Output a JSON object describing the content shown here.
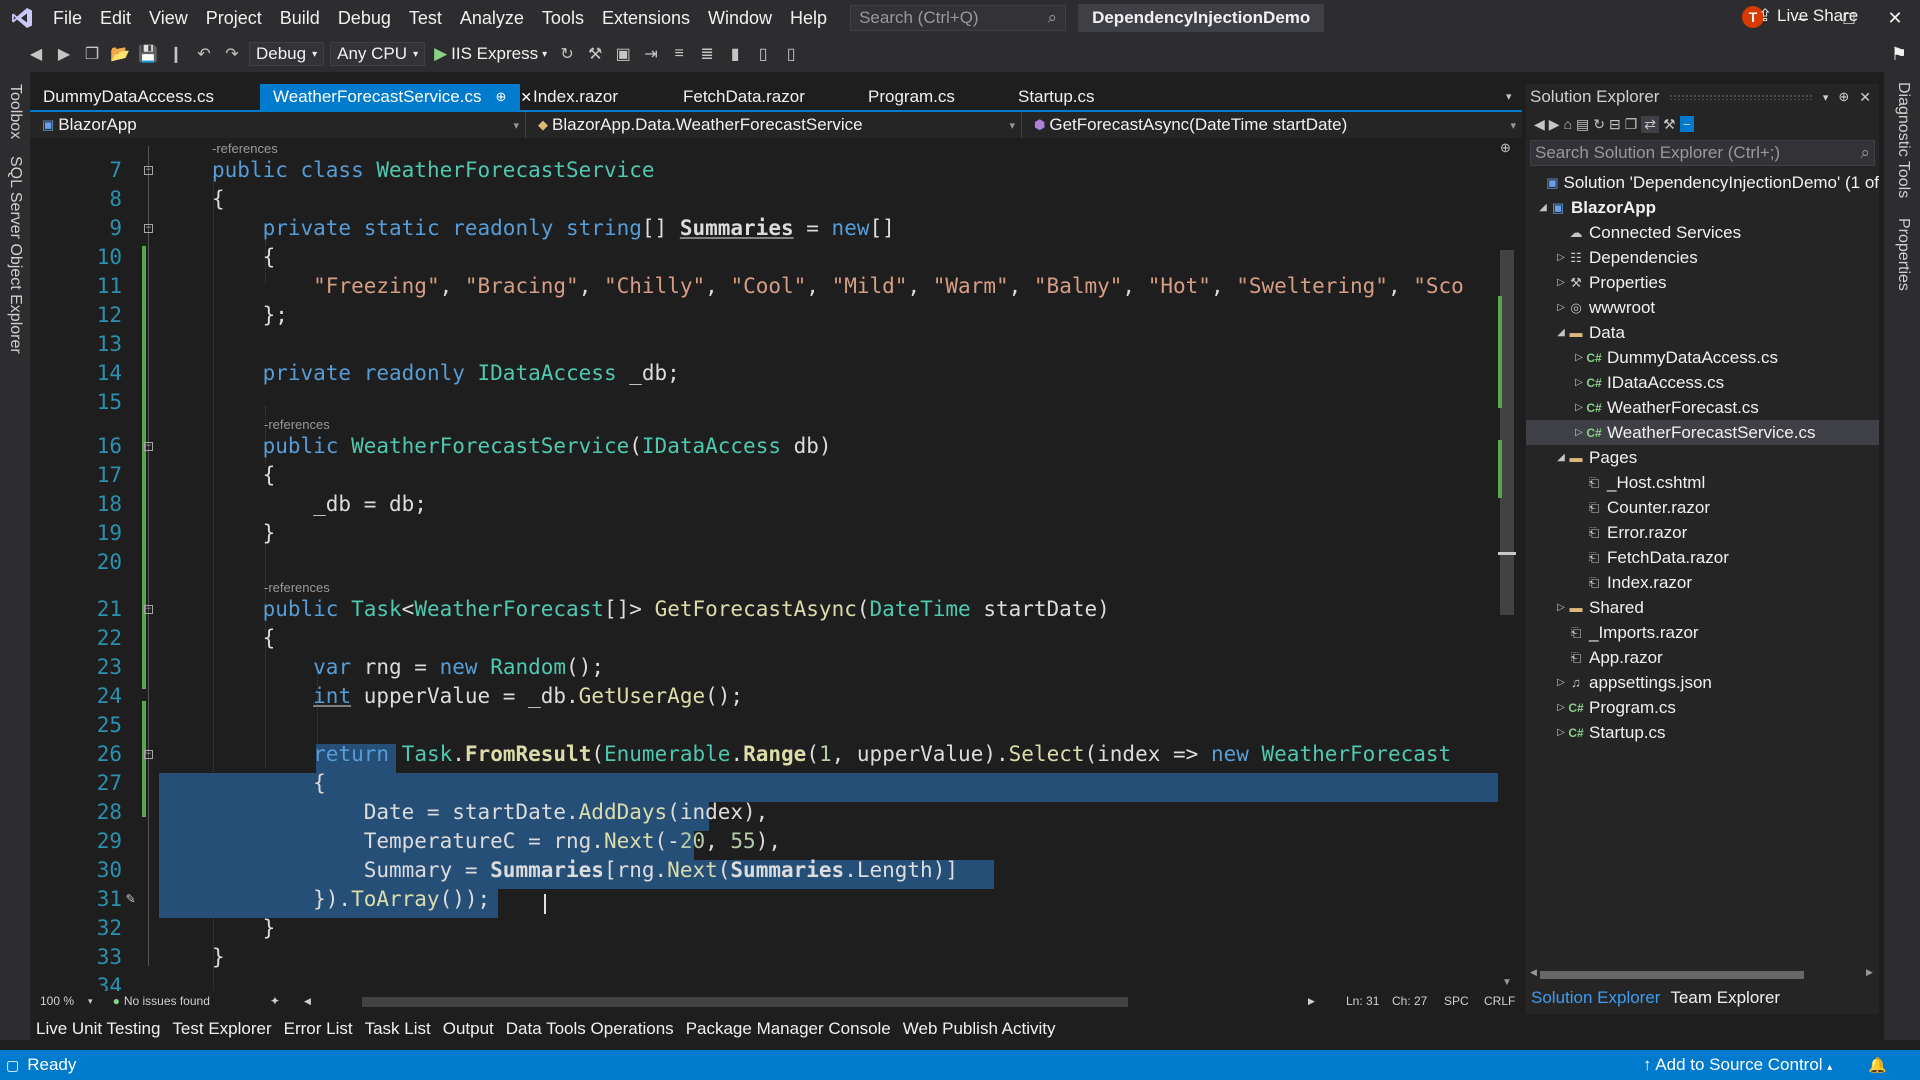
{
  "menu": {
    "items": [
      "File",
      "Edit",
      "View",
      "Project",
      "Build",
      "Debug",
      "Test",
      "Analyze",
      "Tools",
      "Extensions",
      "Window",
      "Help"
    ],
    "search_placeholder": "Search (Ctrl+Q)",
    "solution_name": "DependencyInjectionDemo",
    "avatar_initial": "T"
  },
  "toolbar": {
    "config": "Debug",
    "platform": "Any CPU",
    "run_label": "IIS Express",
    "live_share": "Live Share"
  },
  "left_strip": {
    "toolbox": "Toolbox",
    "sql_explorer": "SQL Server Object Explorer"
  },
  "right_strip": {
    "diagnostic": "Diagnostic Tools",
    "properties": "Properties"
  },
  "tabs": [
    {
      "label": "DummyDataAccess.cs",
      "active": false
    },
    {
      "label": "WeatherForecastService.cs",
      "active": true
    },
    {
      "label": "Index.razor",
      "active": false
    },
    {
      "label": "FetchData.razor",
      "active": false
    },
    {
      "label": "Program.cs",
      "active": false
    },
    {
      "label": "Startup.cs",
      "active": false
    }
  ],
  "navbar": {
    "project": "BlazorApp",
    "type": "BlazorApp.Data.WeatherForecastService",
    "member": "GetForecastAsync(DateTime startDate)"
  },
  "codelens": "-references",
  "line_numbers": [
    "7",
    "8",
    "9",
    "10",
    "11",
    "12",
    "13",
    "14",
    "15",
    "16",
    "17",
    "18",
    "19",
    "20",
    "21",
    "22",
    "23",
    "24",
    "25",
    "26",
    "27",
    "28",
    "29",
    "30",
    "31",
    "32",
    "33",
    "34"
  ],
  "editor_status": {
    "zoom": "100 %",
    "issues": "No issues found",
    "ln": "Ln: 31",
    "ch": "Ch: 27",
    "spc": "SPC",
    "crlf": "CRLF"
  },
  "bottom_tabs": [
    "Live Unit Testing",
    "Test Explorer",
    "Error List",
    "Task List",
    "Output",
    "Data Tools Operations",
    "Package Manager Console",
    "Web Publish Activity"
  ],
  "status": {
    "ready": "Ready",
    "source_control": "Add to Source Control"
  },
  "solution_explorer": {
    "title": "Solution Explorer",
    "search_placeholder": "Search Solution Explorer (Ctrl+;)",
    "tree": [
      {
        "label": "Solution 'DependencyInjectionDemo' (1 of",
        "depth": 0,
        "icon": "solution-icon",
        "twisty": ""
      },
      {
        "label": "BlazorApp",
        "depth": 1,
        "icon": "project-icon",
        "twisty": "open",
        "bold": true
      },
      {
        "label": "Connected Services",
        "depth": 2,
        "icon": "connected-services-icon",
        "twisty": ""
      },
      {
        "label": "Dependencies",
        "depth": 2,
        "icon": "dependencies-icon",
        "twisty": "closed"
      },
      {
        "label": "Properties",
        "depth": 2,
        "icon": "wrench-icon",
        "twisty": "closed"
      },
      {
        "label": "wwwroot",
        "depth": 2,
        "icon": "globe-icon",
        "twisty": "closed"
      },
      {
        "label": "Data",
        "depth": 2,
        "icon": "folder-icon",
        "twisty": "open"
      },
      {
        "label": "DummyDataAccess.cs",
        "depth": 3,
        "icon": "csharp-file-icon",
        "twisty": "closed"
      },
      {
        "label": "IDataAccess.cs",
        "depth": 3,
        "icon": "csharp-file-icon",
        "twisty": "closed"
      },
      {
        "label": "WeatherForecast.cs",
        "depth": 3,
        "icon": "csharp-file-icon",
        "twisty": "closed"
      },
      {
        "label": "WeatherForecastService.cs",
        "depth": 3,
        "icon": "csharp-file-icon",
        "twisty": "closed",
        "selected": true
      },
      {
        "label": "Pages",
        "depth": 2,
        "icon": "folder-icon",
        "twisty": "open"
      },
      {
        "label": "_Host.cshtml",
        "depth": 3,
        "icon": "file-icon",
        "twisty": ""
      },
      {
        "label": "Counter.razor",
        "depth": 3,
        "icon": "file-icon",
        "twisty": ""
      },
      {
        "label": "Error.razor",
        "depth": 3,
        "icon": "file-icon",
        "twisty": ""
      },
      {
        "label": "FetchData.razor",
        "depth": 3,
        "icon": "file-icon",
        "twisty": ""
      },
      {
        "label": "Index.razor",
        "depth": 3,
        "icon": "file-icon",
        "twisty": ""
      },
      {
        "label": "Shared",
        "depth": 2,
        "icon": "folder-icon",
        "twisty": "closed"
      },
      {
        "label": "_Imports.razor",
        "depth": 2,
        "icon": "file-icon",
        "twisty": ""
      },
      {
        "label": "App.razor",
        "depth": 2,
        "icon": "file-icon",
        "twisty": ""
      },
      {
        "label": "appsettings.json",
        "depth": 2,
        "icon": "json-file-icon",
        "twisty": "closed"
      },
      {
        "label": "Program.cs",
        "depth": 2,
        "icon": "csharp-file-icon",
        "twisty": "closed"
      },
      {
        "label": "Startup.cs",
        "depth": 2,
        "icon": "csharp-file-icon",
        "twisty": "closed"
      }
    ],
    "bottom_tabs": [
      {
        "label": "Solution Explorer",
        "active": true
      },
      {
        "label": "Team Explorer",
        "active": false
      }
    ]
  },
  "colors": {
    "accent": "#007acc",
    "selection": "#264f78",
    "keyword": "#569cd6",
    "type": "#4ec9b0",
    "string": "#d69d85",
    "method": "#dcdcaa",
    "line_number": "#2b91af"
  }
}
